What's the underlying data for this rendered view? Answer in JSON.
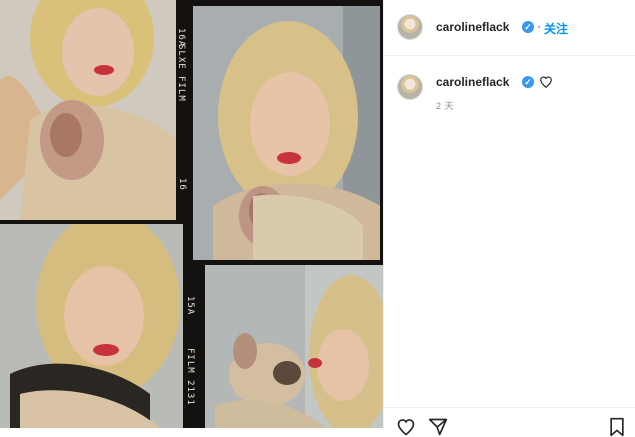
{
  "post": {
    "username": "carolineflack",
    "follow_label": "关注",
    "dot": "·",
    "time_label": "2 天"
  },
  "film": {
    "marks": [
      "16A",
      "SLXE FILM",
      "16",
      "15A",
      "FILM 2131"
    ]
  },
  "icons": {
    "verified": "verified-badge-icon",
    "like": "heart-icon",
    "comment": "comment-icon",
    "share": "paper-plane-icon",
    "save": "bookmark-icon"
  },
  "colors": {
    "accent": "#0095f6",
    "verified": "#3897f0",
    "text": "#262626",
    "muted": "#8e8e8e"
  }
}
